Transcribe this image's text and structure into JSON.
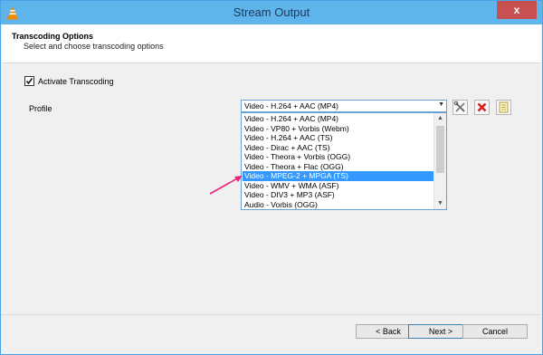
{
  "window": {
    "title": "Stream Output",
    "close_label": "x"
  },
  "header": {
    "title": "Transcoding Options",
    "subtitle": "Select and choose transcoding options"
  },
  "transcoding": {
    "activate_label": "Activate Transcoding",
    "checked": true
  },
  "profile": {
    "label": "Profile",
    "selected": "Video - H.264 + AAC (MP4)",
    "options": [
      "Video - H.264 + AAC (MP4)",
      "Video - VP80 + Vorbis (Webm)",
      "Video - H.264 + AAC (TS)",
      "Video - Dirac + AAC (TS)",
      "Video - Theora + Vorbis (OGG)",
      "Video - Theora + Flac (OGG)",
      "Video - MPEG-2 + MPGA (TS)",
      "Video - WMV + WMA (ASF)",
      "Video - DIV3 + MP3 (ASF)",
      "Audio - Vorbis (OGG)"
    ],
    "highlighted_index": 6,
    "tools": [
      "wrench-screwdriver-icon",
      "delete-x-icon",
      "new-profile-icon"
    ]
  },
  "footer": {
    "back_label": "< Back",
    "next_label": "Next >",
    "cancel_label": "Cancel"
  },
  "colors": {
    "accent": "#5fb4ec",
    "selection": "#3399ff",
    "annotation": "#e8247a",
    "delete": "#d42020"
  }
}
